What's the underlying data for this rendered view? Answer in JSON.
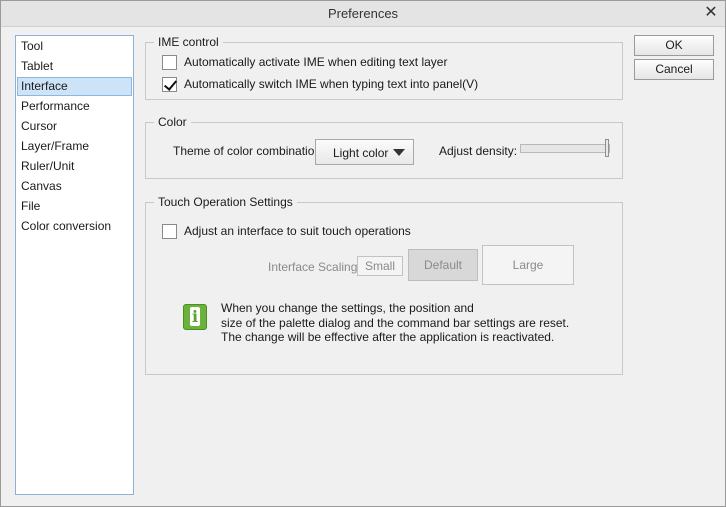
{
  "window": {
    "title": "Preferences",
    "close_glyph": "✕"
  },
  "sidebar": {
    "items": [
      {
        "label": "Tool"
      },
      {
        "label": "Tablet"
      },
      {
        "label": "Interface"
      },
      {
        "label": "Performance"
      },
      {
        "label": "Cursor"
      },
      {
        "label": "Layer/Frame"
      },
      {
        "label": "Ruler/Unit"
      },
      {
        "label": "Canvas"
      },
      {
        "label": "File"
      },
      {
        "label": "Color conversion"
      }
    ],
    "selected": "Interface"
  },
  "buttons": {
    "ok": "OK",
    "cancel": "Cancel"
  },
  "ime": {
    "group_label": "IME control",
    "auto_activate": {
      "label": "Automatically activate IME when editing text layer",
      "checked": false
    },
    "auto_switch": {
      "label": "Automatically switch IME when typing text into panel(V)",
      "checked": true
    }
  },
  "color": {
    "group_label": "Color",
    "theme_label": "Theme of color combination:",
    "theme_value": "Light color",
    "density_label": "Adjust density:",
    "density_level": 1.0
  },
  "touch": {
    "group_label": "Touch Operation Settings",
    "adjust": {
      "label": "Adjust an interface to suit touch operations",
      "checked": false
    },
    "scaling_label": "Interface Scaling:",
    "small": "Small",
    "default": "Default",
    "large": "Large",
    "info_lines": [
      "When you change the settings, the position and",
      "size of the palette dialog and the command bar settings are reset.",
      "The change will be effective after the application is reactivated."
    ]
  },
  "icons": {
    "close": "close-icon",
    "info": "info-icon",
    "dropdown": "chevron-down-icon",
    "check": "checkmark-icon"
  }
}
